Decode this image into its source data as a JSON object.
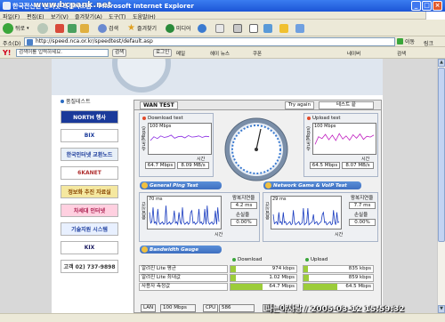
{
  "window": {
    "title_prefix": "ㄴ·",
    "title": "한국전산원 인터넷 측정시스템 - Microsoft Internet Explorer",
    "watermark": "www.bcpank.net",
    "controls": [
      "_",
      "□",
      "×"
    ]
  },
  "menubar": {
    "items": [
      "파일(F)",
      "편집(E)",
      "보기(V)",
      "즐겨찾기(A)",
      "도구(T)",
      "도움말(H)"
    ]
  },
  "toolbar": {
    "back": "뒤로",
    "search": "검색",
    "favorites": "즐겨찾기",
    "media": "미디어"
  },
  "address": {
    "label": "주소(D)",
    "url": "http://speed.nca.or.kr/speedtest/default.asp",
    "go": "이동",
    "links": "링크"
  },
  "yahoo_bar": {
    "logo": "Y!",
    "search_placeholder": "검색어를 입력하세요.",
    "search_button": "검색",
    "login": "로그인",
    "mail": "메일",
    "news": "헤이 뉴스",
    "coupon": "쿠폰",
    "naver": "네이버",
    "right_search": "검색"
  },
  "left_nav": {
    "title": "품질테스트",
    "banners": [
      {
        "label": "NORTH 행사",
        "bg": "#1a3a9a",
        "fg": "#ffffff"
      },
      {
        "label": "BIX",
        "bg": "#ffffff",
        "fg": "#1a3a9a"
      },
      {
        "label": "한국인터넷 교환노드",
        "bg": "#e8f0f8",
        "fg": "#1a3a9a"
      },
      {
        "label": "6KANET",
        "bg": "#ffffff",
        "fg": "#b03030"
      },
      {
        "label": "정보화 추진 자료실",
        "bg": "#f5e8a0",
        "fg": "#884400"
      },
      {
        "label": "차세대 인터넷",
        "bg": "#ffd0e0",
        "fg": "#aa2050"
      },
      {
        "label": "기술지원 시스템",
        "bg": "#e8f0ff",
        "fg": "#2040a0"
      },
      {
        "label": "KIX",
        "bg": "#ffffff",
        "fg": "#1a1a60"
      },
      {
        "label": "고객 02) 737-9898",
        "bg": "#ffffff",
        "fg": "#333333"
      }
    ]
  },
  "wan": {
    "tab": "WAN TEST",
    "try_again": "Try again",
    "end_test": "테스트 끝"
  },
  "download": {
    "title": "Download test",
    "max": "100 Mbps",
    "time_label": "시간",
    "ylabel": "속도(Mbps)",
    "percent": "64.7 Mbps",
    "speed": "8.09 MB/s",
    "trace": [
      3,
      4,
      3.5,
      4.2,
      3.8,
      4,
      4.4,
      3.6,
      4,
      4.1,
      3.7,
      4.3,
      3.9,
      4,
      4.2,
      3.8,
      4.1,
      4
    ]
  },
  "upload": {
    "title": "Upload test",
    "max": "100 Mbps",
    "time_label": "시간",
    "ylabel": "속도(Mbps)",
    "percent": "64.5 Mbps",
    "speed": "8.07 MB/s",
    "trace": [
      2,
      4,
      3.5,
      4.6,
      3.2,
      4.4,
      3,
      4.8,
      3.4,
      4.2,
      3.1,
      4.5,
      3.6,
      4.7,
      3.3,
      4.1,
      3.9,
      4.4
    ]
  },
  "ping": {
    "bar": "General Ping Test",
    "ms": "70 ms",
    "ylabel": "응답시간",
    "delay_label": "왕복지연율",
    "delay": "4.2 ms",
    "loss_label": "손실율",
    "loss": "0.00%",
    "time_label": "시간"
  },
  "game": {
    "bar": "Network Game & VoIP Test",
    "ms": "29 ms",
    "ylabel": "응답시간",
    "delay_label": "왕복지연율",
    "delay": "7.7 ms",
    "loss_label": "손실율",
    "loss": "0.00%",
    "time_label": "시간"
  },
  "bandwidth": {
    "bar": "Bandwidth Gauge",
    "download_label": "Download",
    "upload_label": "Upload",
    "rows": [
      {
        "label": "알려진 Lite 평균",
        "down": "974 kbps",
        "up": "835 kbps",
        "down_frac": 0.16,
        "up_frac": 0.14
      },
      {
        "label": "알려진 Lite 최대값",
        "down": "1.02 Mbps",
        "up": "859 kbps",
        "down_frac": 0.17,
        "up_frac": 0.15
      },
      {
        "label": "사용자 측정값",
        "down": "64.7 Mbps",
        "up": "64.5 Mbps",
        "down_frac": 1.0,
        "up_frac": 1.0
      }
    ]
  },
  "bottom": {
    "lan": "LAN",
    "lan_speed": "100 Mbps",
    "cpu": "CPU",
    "cpu_value": "586",
    "client": "Cli"
  },
  "stamp": "나는야사랑 / 2005-03-12 15:59:32",
  "colors": {
    "titlebar": "#1c55d6",
    "section_bar": "#3e6fc0",
    "download_trace": "#8a2be2",
    "upload_trace": "#c020c0",
    "ping_trace": "#1a3cc0",
    "bar_green": "#9ccc3a"
  }
}
